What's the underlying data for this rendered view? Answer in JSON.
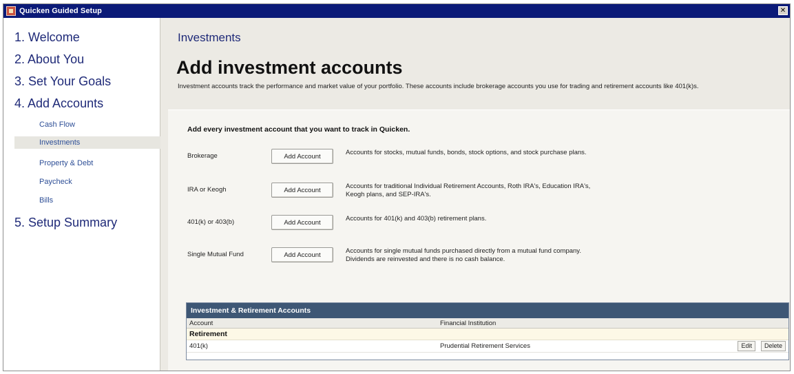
{
  "window": {
    "title": "Quicken Guided Setup",
    "close_glyph": "✕"
  },
  "sidebar": {
    "steps": [
      {
        "label": "1. Welcome"
      },
      {
        "label": "2. About You"
      },
      {
        "label": "3. Set Your Goals"
      },
      {
        "label": "4. Add Accounts"
      },
      {
        "label": "5. Setup Summary"
      }
    ],
    "substeps": [
      {
        "label": "Cash Flow",
        "active": false
      },
      {
        "label": "Investments",
        "active": true
      },
      {
        "label": "Property & Debt",
        "active": false
      },
      {
        "label": "Paycheck",
        "active": false
      },
      {
        "label": "Bills",
        "active": false
      }
    ]
  },
  "main": {
    "section_title": "Investments",
    "heading": "Add investment accounts",
    "description": "Investment accounts track the performance and market value of your portfolio. These accounts include brokerage accounts you use for trading and retirement accounts like 401(k)s.",
    "panel_heading": "Add every investment account that you want to track in Quicken.",
    "account_types": [
      {
        "label": "Brokerage",
        "button": "Add Account",
        "description": "Accounts for stocks, mutual funds, bonds, stock options, and stock purchase plans."
      },
      {
        "label": "IRA or Keogh",
        "button": "Add Account",
        "description": "Accounts for traditional Individual Retirement Accounts, Roth IRA's, Education IRA's, Keogh plans, and SEP-IRA's."
      },
      {
        "label": "401(k) or 403(b)",
        "button": "Add Account",
        "description": "Accounts for 401(k) and 403(b) retirement plans."
      },
      {
        "label": "Single Mutual Fund",
        "button": "Add Account",
        "description": "Accounts for single mutual funds purchased directly from a mutual fund company. Dividends are reinvested and there is no cash balance."
      }
    ],
    "table": {
      "title": "Investment & Retirement Accounts",
      "columns": [
        "Account",
        "Financial Institution"
      ],
      "group": "Retirement",
      "rows": [
        {
          "account": "401(k)",
          "institution": "Prudential Retirement Services",
          "edit": "Edit",
          "delete": "Delete"
        }
      ]
    }
  },
  "colors": {
    "titlebar": "#0b1a78",
    "step_text": "#1f2a78",
    "substep_text": "#2d4e96",
    "table_header": "#3e5775",
    "background": "#eceae4"
  }
}
